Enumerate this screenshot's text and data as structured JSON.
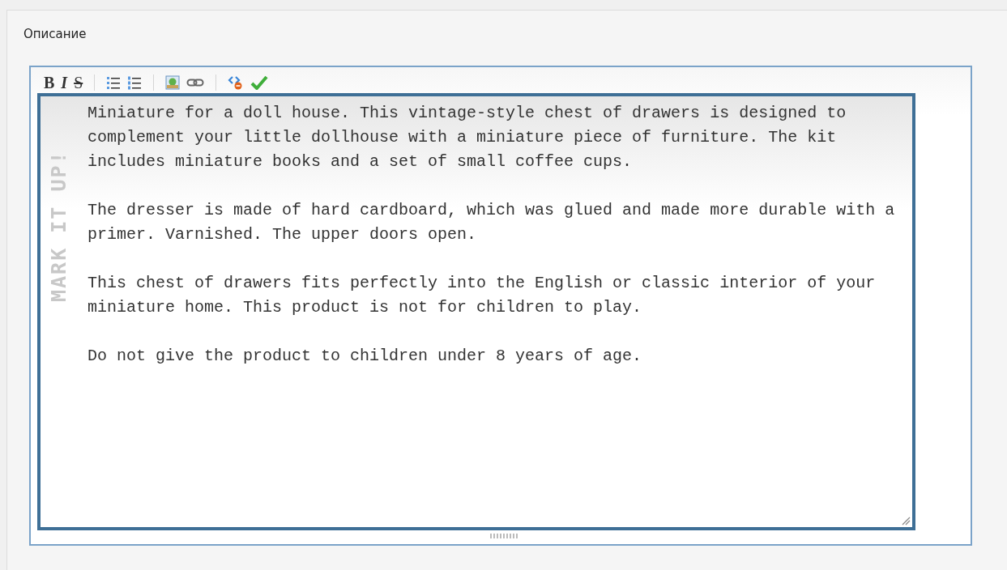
{
  "section": {
    "title": "Описание"
  },
  "editor": {
    "toolbar": [
      {
        "kind": "bold",
        "label": "B"
      },
      {
        "kind": "italic",
        "label": "I"
      },
      {
        "kind": "strike",
        "label": "S"
      },
      {
        "kind": "separator"
      },
      {
        "kind": "bullet-list"
      },
      {
        "kind": "numbered-list"
      },
      {
        "kind": "separator"
      },
      {
        "kind": "picture"
      },
      {
        "kind": "link"
      },
      {
        "kind": "separator"
      },
      {
        "kind": "clean"
      },
      {
        "kind": "preview"
      }
    ],
    "logo_text": "MARK IT UP!",
    "paragraphs": [
      "Miniature for a doll house. This vintage-style chest of drawers is designed to complement your little dollhouse with a miniature piece of furniture. The kit includes miniature books and a set of small coffee cups.",
      "The dresser is made of hard cardboard, which was glued and made more durable with a primer. Varnished. The upper doors open.",
      "This chest of drawers fits perfectly into the English or classic interior of your miniature home. This product is not for children to play.",
      "Do not give the product to children under 8 years of age."
    ]
  }
}
